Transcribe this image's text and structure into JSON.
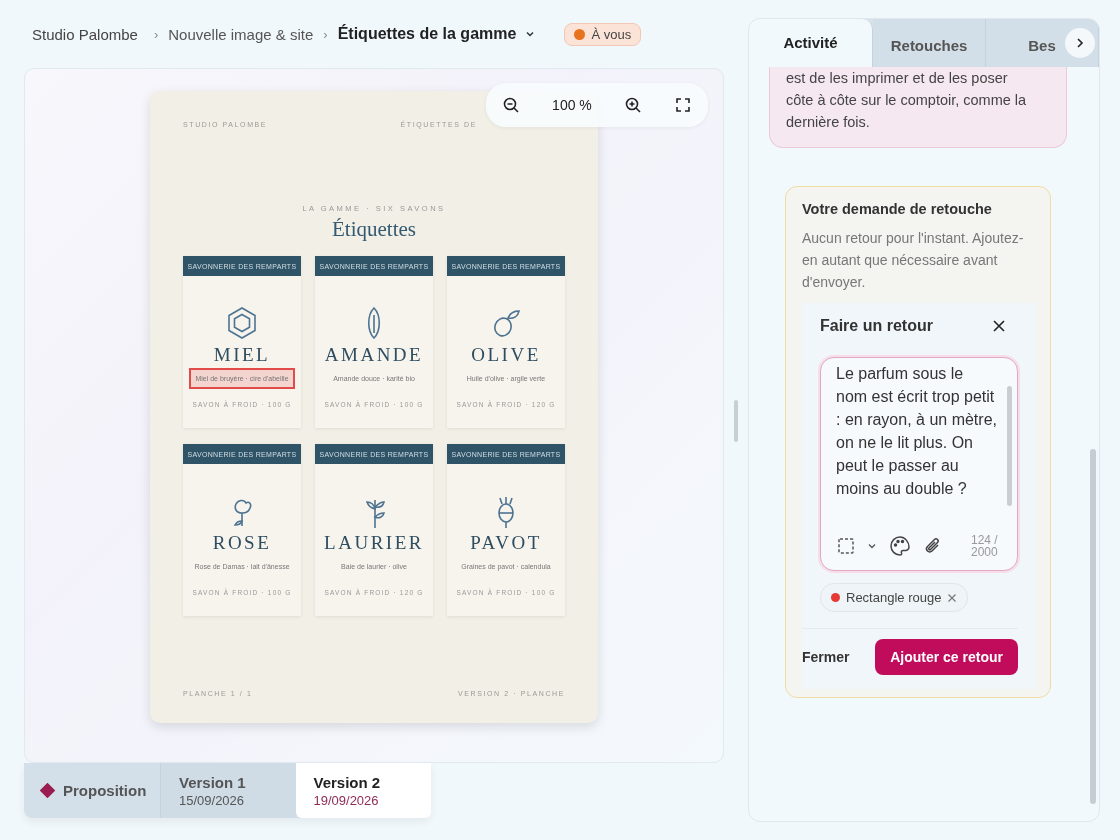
{
  "breadcrumb": {
    "items": [
      {
        "label": "Studio Palombe"
      },
      {
        "sep": "›",
        "label": "Nouvelle image & site"
      },
      {
        "sep": "›",
        "label": "Étiquettes de la gamme"
      }
    ],
    "badge": {
      "label": "À vous",
      "color": "#e8731f"
    }
  },
  "zoom": {
    "value": "100 %"
  },
  "artboard": {
    "header_left": "STUDIO PALOMBE",
    "header_right": "ÉTIQUETTES DE",
    "kicker": "LA GAMME · SIX SAVONS",
    "title": "Étiquettes",
    "labels": [
      {
        "brand": "SAVONNERIE DES REMPARTS",
        "kind": "hexagon",
        "name": "MIEL",
        "scent": "Miel de bruyère · cire d'abeille",
        "weight": "SAVON À FROID · 100 G",
        "highlighted": true
      },
      {
        "brand": "SAVONNERIE DES REMPARTS",
        "kind": "leaf",
        "name": "AMANDE",
        "scent": "Amande douce · karité bio",
        "weight": "SAVON À FROID · 100 G",
        "highlighted": false
      },
      {
        "brand": "SAVONNERIE DES REMPARTS",
        "kind": "olive",
        "name": "OLIVE",
        "scent": "Huile d'olive · argile verte",
        "weight": "SAVON À FROID · 120 G",
        "highlighted": false
      },
      {
        "brand": "SAVONNERIE DES REMPARTS",
        "kind": "rose",
        "name": "ROSE",
        "scent": "Rose de Damas · lait d'ânesse",
        "weight": "SAVON À FROID · 100 G",
        "highlighted": false
      },
      {
        "brand": "SAVONNERIE DES REMPARTS",
        "kind": "sprig",
        "name": "LAURIER",
        "scent": "Baie de laurier · olive",
        "weight": "SAVON À FROID · 120 G",
        "highlighted": false
      },
      {
        "brand": "SAVONNERIE DES REMPARTS",
        "kind": "poppy",
        "name": "PAVOT",
        "scent": "Graines de pavot · calendula",
        "weight": "SAVON À FROID · 100 G",
        "highlighted": false
      }
    ],
    "footer_left": "PLANCHE 1 / 1",
    "footer_right": "VERSION 2 · PLANCHE"
  },
  "versions": [
    {
      "kind": "proposal",
      "label": "Proposition",
      "color": "#9b1c4f",
      "selected": false
    },
    {
      "kind": "version",
      "label": "Version 1",
      "date": "15/09/2026",
      "selected": false
    },
    {
      "kind": "version",
      "label": "Version 2",
      "date": "19/09/2026",
      "selected": true
    }
  ],
  "panel": {
    "tabs": [
      {
        "label": "Activité",
        "selected": true
      },
      {
        "label": "Retouches",
        "selected": false
      },
      {
        "label": "Bes",
        "selected": false
      }
    ],
    "message": "est de les imprimer et de les poser côte à côte sur le comptoir, comme la dernière fois.",
    "request": {
      "title": "Votre demande de retouche",
      "text": "Aucun retour pour l'instant. Ajoutez-en autant que nécessaire avant d'envoyer.",
      "form": {
        "title": "Faire un retour",
        "value": "Le parfum sous le nom est écrit trop petit : en rayon, à un mètre, on ne le lit plus. On peut le passer au moins au double ?",
        "counter": "124 / 2000",
        "attachments": [
          {
            "label": "Rectangle rouge",
            "color": "#e53935"
          }
        ],
        "cancel": "Fermer",
        "submit": "Ajouter ce retour"
      }
    }
  }
}
